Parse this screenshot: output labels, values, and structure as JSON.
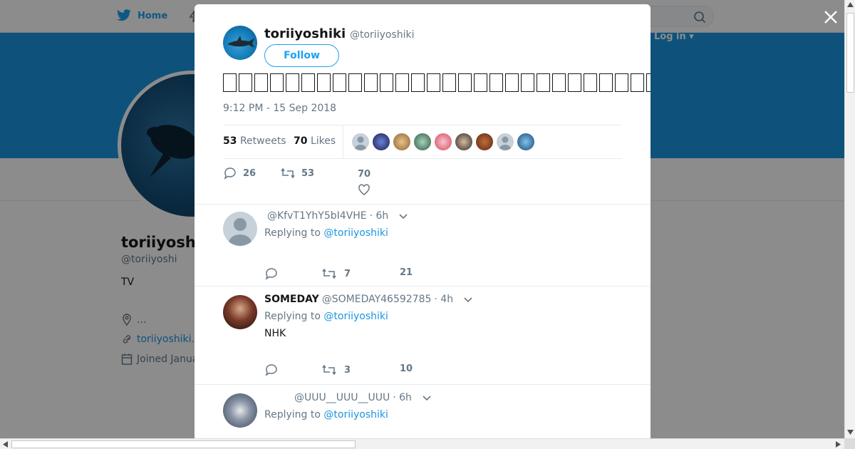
{
  "background": {
    "nav_home_label": "Home",
    "login_label": "Log in ▾",
    "profile_name": "toriiyosh",
    "profile_handle": "@toriiyoshi",
    "profile_bio": "TV",
    "location": "...",
    "website": "toriiyoshiki.",
    "joined": "Joined Janua"
  },
  "tweet": {
    "display_name": "toriiyoshiki",
    "handle": "@toriiyoshiki",
    "follow_label": "Follow",
    "text_glyph_count": 48,
    "timestamp": "9:12 PM - 15 Sep 2018",
    "retweets_count": "53",
    "retweets_label": "Retweets",
    "likes_count": "70",
    "likes_label": "Likes",
    "likers": [
      "default-avatar",
      "blue-galaxy-avatar",
      "cartoon-avatar",
      "green-pattern-avatar",
      "anime-avatar",
      "man-avatar",
      "brown-avatar",
      "default-avatar",
      "blue-avatar"
    ],
    "actions": {
      "replies": "26",
      "retweets": "53",
      "likes": "70"
    }
  },
  "replies": [
    {
      "name": "",
      "handle": "@KfvT1YhY5bI4VHE",
      "time": "· 6h",
      "replying_prefix": "Replying to",
      "replying_to": "@toriiyoshiki",
      "text": "",
      "retweets": "7",
      "likes": "21"
    },
    {
      "name": "SOMEDAY",
      "handle": "@SOMEDAY46592785",
      "time": "· 4h",
      "replying_prefix": "Replying to",
      "replying_to": "@toriiyoshiki",
      "text": "NHK",
      "retweets": "3",
      "likes": "10"
    },
    {
      "name": "",
      "handle": "@UUU__UUU__UUU",
      "time": "· 6h",
      "replying_prefix": "Replying to",
      "replying_to": "@toriiyoshiki",
      "text": "",
      "retweets": "",
      "likes": ""
    }
  ],
  "colors": {
    "accent": "#1da1f2",
    "banner": "#1b95e0",
    "text": "#14171a",
    "muted": "#657786"
  }
}
